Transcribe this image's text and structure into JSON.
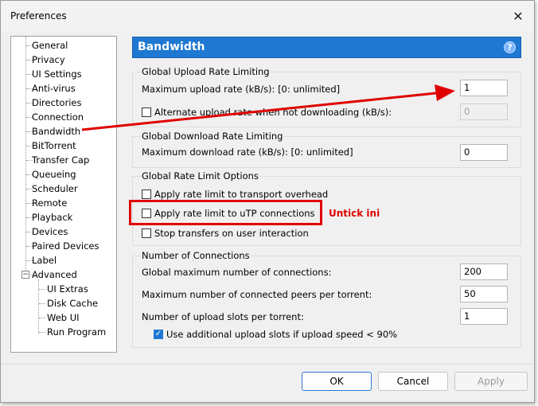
{
  "window": {
    "title": "Preferences"
  },
  "tree": {
    "items": [
      "General",
      "Privacy",
      "UI Settings",
      "Anti-virus",
      "Directories",
      "Connection",
      "Bandwidth",
      "BitTorrent",
      "Transfer Cap",
      "Queueing",
      "Scheduler",
      "Remote",
      "Playback",
      "Devices",
      "Paired Devices",
      "Label",
      "Advanced"
    ],
    "sub_items": [
      "UI Extras",
      "Disk Cache",
      "Web UI",
      "Run Program"
    ],
    "selected": "Bandwidth",
    "advanced_expander": "−"
  },
  "header": {
    "title": "Bandwidth",
    "help": "?"
  },
  "upload": {
    "group_title": "Global Upload Rate Limiting",
    "max_label": "Maximum upload rate (kB/s): [0: unlimited]",
    "max_value": "1",
    "alt_label": "Alternate upload rate when not downloading (kB/s):",
    "alt_value": "0"
  },
  "download": {
    "group_title": "Global Download Rate Limiting",
    "max_label": "Maximum download rate (kB/s): [0: unlimited]",
    "max_value": "0"
  },
  "limit_options": {
    "group_title": "Global Rate Limit Options",
    "opt1": "Apply rate limit to transport overhead",
    "opt2": "Apply rate limit to uTP connections",
    "opt3": "Stop transfers on user interaction"
  },
  "connections": {
    "group_title": "Number of Connections",
    "global_label": "Global maximum number of connections:",
    "global_value": "200",
    "peers_label": "Maximum number of connected peers per torrent:",
    "peers_value": "50",
    "slots_label": "Number of upload slots per torrent:",
    "slots_value": "1",
    "extra_label": "Use additional upload slots if upload speed < 90%"
  },
  "buttons": {
    "ok": "OK",
    "cancel": "Cancel",
    "apply": "Apply"
  },
  "annotation": {
    "text": "Untick ini",
    "color": "#e00000"
  },
  "colors": {
    "accent": "#1f78d1"
  }
}
